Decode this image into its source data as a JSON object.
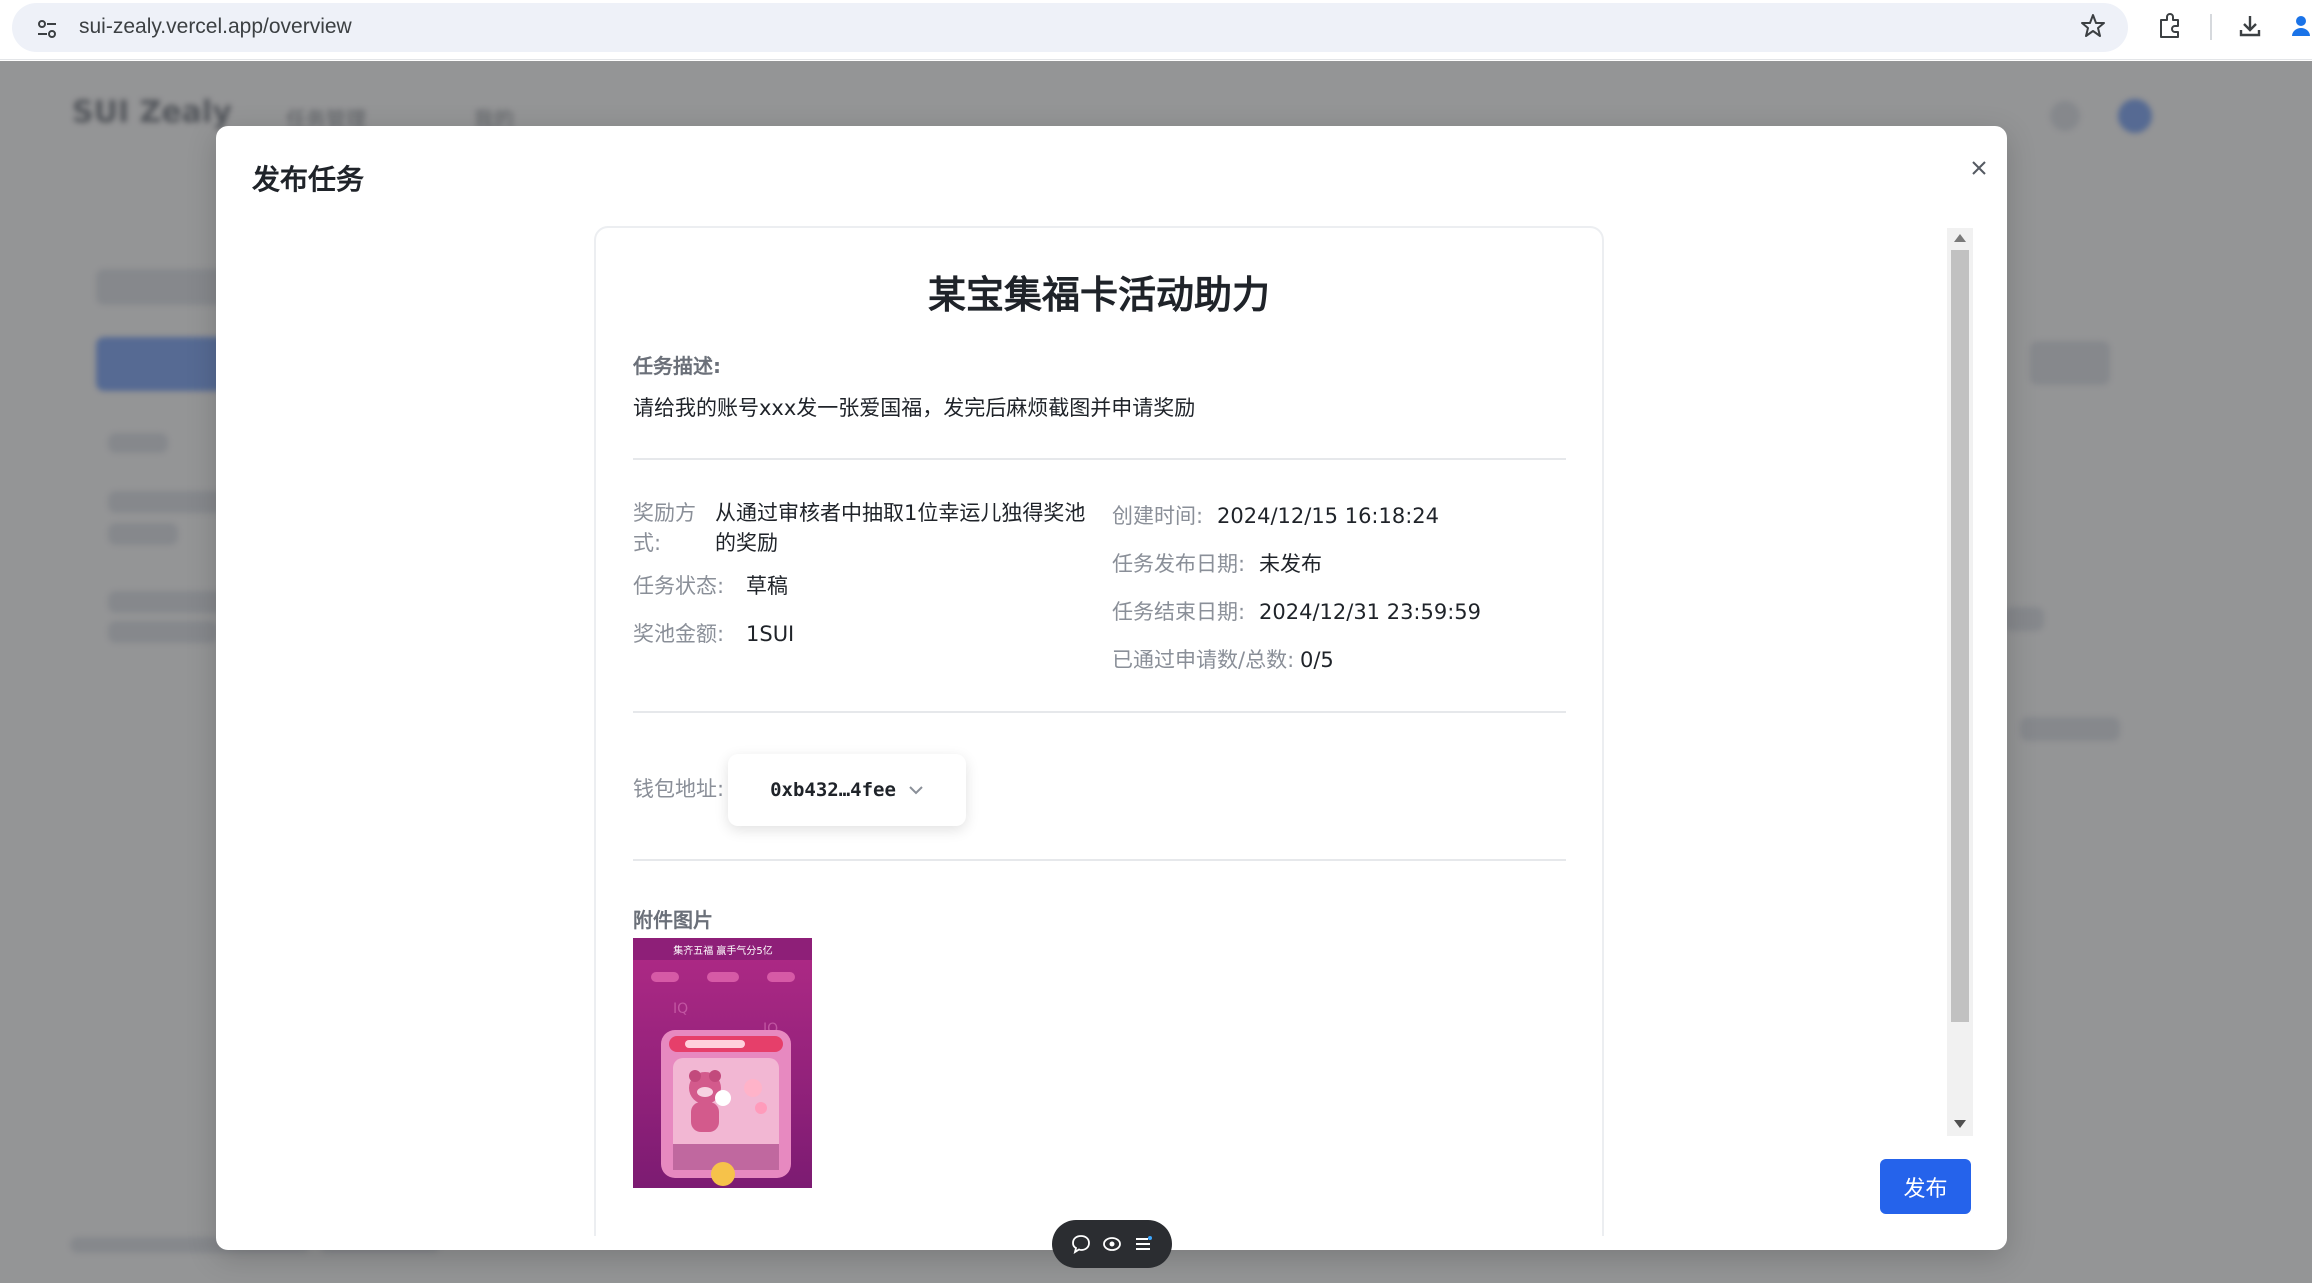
{
  "browser": {
    "url": "sui-zealy.vercel.app/overview",
    "icons": [
      "site-settings-icon",
      "star-icon",
      "extensions-icon",
      "download-icon",
      "profile-icon"
    ]
  },
  "background_page": {
    "logo": "SUI Zealy",
    "nav": [
      "任务管理",
      "我的"
    ]
  },
  "modal": {
    "title": "发布任务",
    "close_icon": "close-icon",
    "publish_label": "发布"
  },
  "task": {
    "title": "某宝集福卡活动助力",
    "desc_label": "任务描述:",
    "desc": "请给我的账号xxx发一张爱国福，发完后麻烦截图并申请奖励",
    "reward_method_label_1": "奖励方",
    "reward_method_label_2": "式:",
    "reward_method_line_1": "从通过审核者中抽取1位幸运儿独得奖池",
    "reward_method_line_2": "的奖励",
    "status_label": "任务状态:",
    "status": "草稿",
    "pool_label": "奖池金额:",
    "pool": "1SUI",
    "created_label": "创建时间:",
    "created": "2024/12/15 16:18:24",
    "publish_date_label": "任务发布日期:",
    "publish_date": "未发布",
    "end_date_label": "任务结束日期:",
    "end_date": "2024/12/31 23:59:59",
    "approved_label": "已通过申请数/总数:",
    "approved": "0/5",
    "wallet_label": "钱包地址:",
    "wallet": "0xb432…4fee",
    "attachments_label": "附件图片",
    "attachment_caption": "集齐五福 赢手气分5亿"
  },
  "colors": {
    "primary": "#2563eb",
    "overlay": "rgba(0,0,0,0.40)",
    "attachment_bg": "#a4257e"
  }
}
